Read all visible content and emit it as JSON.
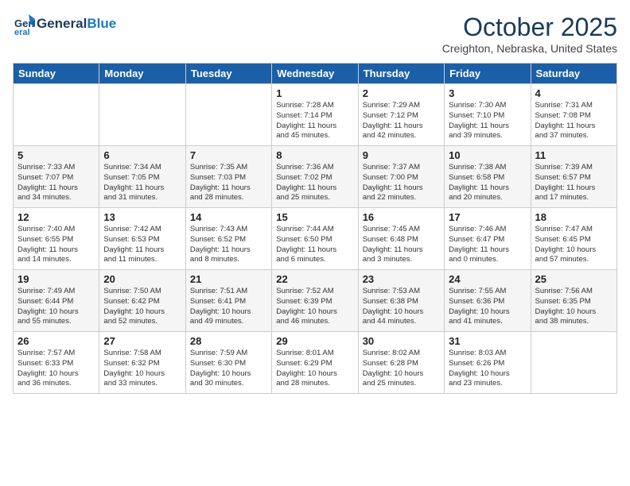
{
  "header": {
    "logo_line1": "General",
    "logo_line2": "Blue",
    "month": "October 2025",
    "location": "Creighton, Nebraska, United States"
  },
  "weekdays": [
    "Sunday",
    "Monday",
    "Tuesday",
    "Wednesday",
    "Thursday",
    "Friday",
    "Saturday"
  ],
  "weeks": [
    [
      {
        "day": "",
        "info": ""
      },
      {
        "day": "",
        "info": ""
      },
      {
        "day": "",
        "info": ""
      },
      {
        "day": "1",
        "info": "Sunrise: 7:28 AM\nSunset: 7:14 PM\nDaylight: 11 hours\nand 45 minutes."
      },
      {
        "day": "2",
        "info": "Sunrise: 7:29 AM\nSunset: 7:12 PM\nDaylight: 11 hours\nand 42 minutes."
      },
      {
        "day": "3",
        "info": "Sunrise: 7:30 AM\nSunset: 7:10 PM\nDaylight: 11 hours\nand 39 minutes."
      },
      {
        "day": "4",
        "info": "Sunrise: 7:31 AM\nSunset: 7:08 PM\nDaylight: 11 hours\nand 37 minutes."
      }
    ],
    [
      {
        "day": "5",
        "info": "Sunrise: 7:33 AM\nSunset: 7:07 PM\nDaylight: 11 hours\nand 34 minutes."
      },
      {
        "day": "6",
        "info": "Sunrise: 7:34 AM\nSunset: 7:05 PM\nDaylight: 11 hours\nand 31 minutes."
      },
      {
        "day": "7",
        "info": "Sunrise: 7:35 AM\nSunset: 7:03 PM\nDaylight: 11 hours\nand 28 minutes."
      },
      {
        "day": "8",
        "info": "Sunrise: 7:36 AM\nSunset: 7:02 PM\nDaylight: 11 hours\nand 25 minutes."
      },
      {
        "day": "9",
        "info": "Sunrise: 7:37 AM\nSunset: 7:00 PM\nDaylight: 11 hours\nand 22 minutes."
      },
      {
        "day": "10",
        "info": "Sunrise: 7:38 AM\nSunset: 6:58 PM\nDaylight: 11 hours\nand 20 minutes."
      },
      {
        "day": "11",
        "info": "Sunrise: 7:39 AM\nSunset: 6:57 PM\nDaylight: 11 hours\nand 17 minutes."
      }
    ],
    [
      {
        "day": "12",
        "info": "Sunrise: 7:40 AM\nSunset: 6:55 PM\nDaylight: 11 hours\nand 14 minutes."
      },
      {
        "day": "13",
        "info": "Sunrise: 7:42 AM\nSunset: 6:53 PM\nDaylight: 11 hours\nand 11 minutes."
      },
      {
        "day": "14",
        "info": "Sunrise: 7:43 AM\nSunset: 6:52 PM\nDaylight: 11 hours\nand 8 minutes."
      },
      {
        "day": "15",
        "info": "Sunrise: 7:44 AM\nSunset: 6:50 PM\nDaylight: 11 hours\nand 6 minutes."
      },
      {
        "day": "16",
        "info": "Sunrise: 7:45 AM\nSunset: 6:48 PM\nDaylight: 11 hours\nand 3 minutes."
      },
      {
        "day": "17",
        "info": "Sunrise: 7:46 AM\nSunset: 6:47 PM\nDaylight: 11 hours\nand 0 minutes."
      },
      {
        "day": "18",
        "info": "Sunrise: 7:47 AM\nSunset: 6:45 PM\nDaylight: 10 hours\nand 57 minutes."
      }
    ],
    [
      {
        "day": "19",
        "info": "Sunrise: 7:49 AM\nSunset: 6:44 PM\nDaylight: 10 hours\nand 55 minutes."
      },
      {
        "day": "20",
        "info": "Sunrise: 7:50 AM\nSunset: 6:42 PM\nDaylight: 10 hours\nand 52 minutes."
      },
      {
        "day": "21",
        "info": "Sunrise: 7:51 AM\nSunset: 6:41 PM\nDaylight: 10 hours\nand 49 minutes."
      },
      {
        "day": "22",
        "info": "Sunrise: 7:52 AM\nSunset: 6:39 PM\nDaylight: 10 hours\nand 46 minutes."
      },
      {
        "day": "23",
        "info": "Sunrise: 7:53 AM\nSunset: 6:38 PM\nDaylight: 10 hours\nand 44 minutes."
      },
      {
        "day": "24",
        "info": "Sunrise: 7:55 AM\nSunset: 6:36 PM\nDaylight: 10 hours\nand 41 minutes."
      },
      {
        "day": "25",
        "info": "Sunrise: 7:56 AM\nSunset: 6:35 PM\nDaylight: 10 hours\nand 38 minutes."
      }
    ],
    [
      {
        "day": "26",
        "info": "Sunrise: 7:57 AM\nSunset: 6:33 PM\nDaylight: 10 hours\nand 36 minutes."
      },
      {
        "day": "27",
        "info": "Sunrise: 7:58 AM\nSunset: 6:32 PM\nDaylight: 10 hours\nand 33 minutes."
      },
      {
        "day": "28",
        "info": "Sunrise: 7:59 AM\nSunset: 6:30 PM\nDaylight: 10 hours\nand 30 minutes."
      },
      {
        "day": "29",
        "info": "Sunrise: 8:01 AM\nSunset: 6:29 PM\nDaylight: 10 hours\nand 28 minutes."
      },
      {
        "day": "30",
        "info": "Sunrise: 8:02 AM\nSunset: 6:28 PM\nDaylight: 10 hours\nand 25 minutes."
      },
      {
        "day": "31",
        "info": "Sunrise: 8:03 AM\nSunset: 6:26 PM\nDaylight: 10 hours\nand 23 minutes."
      },
      {
        "day": "",
        "info": ""
      }
    ]
  ]
}
